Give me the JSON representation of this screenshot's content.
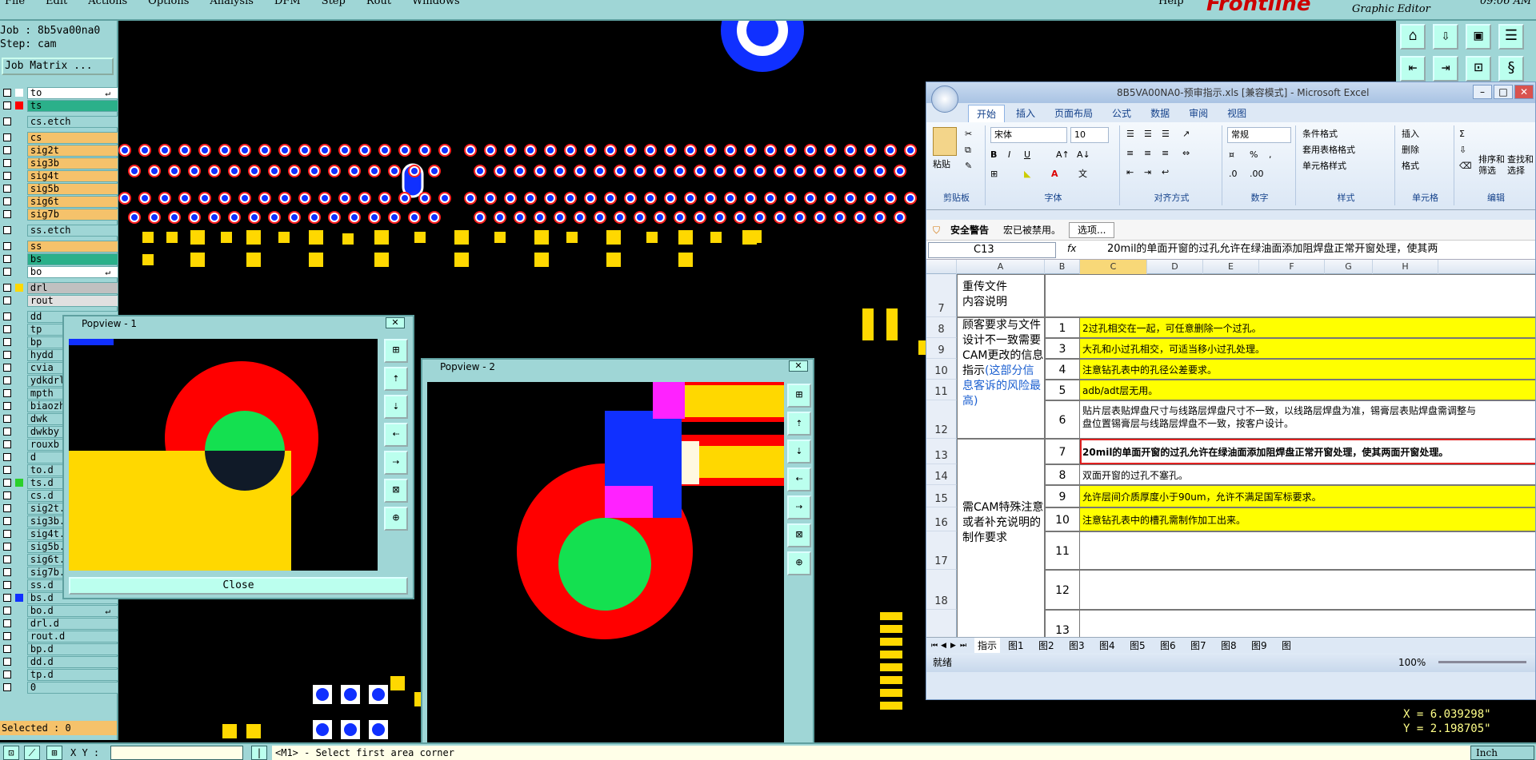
{
  "menu": {
    "items": [
      "File",
      "Edit",
      "Actions",
      "Options",
      "Analysis",
      "DFM",
      "Step",
      "Rout",
      "Windows"
    ],
    "help": "Help"
  },
  "brand": {
    "logo": "Frontline",
    "subtitle": "Graphic Editor",
    "time": "09:06 AM"
  },
  "job": {
    "job_line": "Job : 8b5va00na0",
    "step_line": "Step: cam",
    "matrix_button": "Job Matrix ..."
  },
  "layers": [
    {
      "name": "to",
      "color": "#ffffff",
      "swatch": "#ffffff",
      "arrow": true
    },
    {
      "name": "ts",
      "color": "#2bb08a",
      "swatch": "#ff0000"
    },
    {
      "name": "cs.etch",
      "color": "#9fd6d6",
      "swatch": "#9fd6d6",
      "gap": true
    },
    {
      "name": "cs",
      "color": "#f5c26b",
      "swatch": "#9fd6d6",
      "gap": true
    },
    {
      "name": "sig2t",
      "color": "#f5c26b",
      "swatch": "#9fd6d6"
    },
    {
      "name": "sig3b",
      "color": "#f5c26b",
      "swatch": "#9fd6d6"
    },
    {
      "name": "sig4t",
      "color": "#f5c26b",
      "swatch": "#9fd6d6"
    },
    {
      "name": "sig5b",
      "color": "#f5c26b",
      "swatch": "#9fd6d6"
    },
    {
      "name": "sig6t",
      "color": "#f5c26b",
      "swatch": "#9fd6d6"
    },
    {
      "name": "sig7b",
      "color": "#f5c26b",
      "swatch": "#9fd6d6"
    },
    {
      "name": "ss.etch",
      "color": "#9fd6d6",
      "swatch": "#9fd6d6",
      "gap": true
    },
    {
      "name": "ss",
      "color": "#f5c26b",
      "swatch": "#9fd6d6",
      "gap": true
    },
    {
      "name": "bs",
      "color": "#2bb08a",
      "swatch": "#9fd6d6"
    },
    {
      "name": "bo",
      "color": "#ffffff",
      "swatch": "#9fd6d6",
      "arrow": true
    },
    {
      "name": "drl",
      "color": "#c0c0c0",
      "swatch": "#ffd800",
      "gap": true
    },
    {
      "name": "rout",
      "color": "#e0e0e0",
      "swatch": "#9fd6d6"
    },
    {
      "name": "dd",
      "color": "#9fd6d6",
      "swatch": "#9fd6d6",
      "gap": true
    },
    {
      "name": "tp",
      "color": "#9fd6d6",
      "swatch": "#9fd6d6"
    },
    {
      "name": "bp",
      "color": "#9fd6d6",
      "swatch": "#9fd6d6"
    },
    {
      "name": "hydd",
      "color": "#9fd6d6",
      "swatch": "#9fd6d6"
    },
    {
      "name": "cvia",
      "color": "#9fd6d6",
      "swatch": "#9fd6d6"
    },
    {
      "name": "ydkdrl",
      "color": "#9fd6d6",
      "swatch": "#9fd6d6"
    },
    {
      "name": "mpth",
      "color": "#9fd6d6",
      "swatch": "#9fd6d6"
    },
    {
      "name": "biaozh",
      "color": "#9fd6d6",
      "swatch": "#9fd6d6"
    },
    {
      "name": "dwk",
      "color": "#9fd6d6",
      "swatch": "#9fd6d6"
    },
    {
      "name": "dwkby",
      "color": "#9fd6d6",
      "swatch": "#9fd6d6"
    },
    {
      "name": "rouxb",
      "color": "#9fd6d6",
      "swatch": "#9fd6d6"
    },
    {
      "name": "d",
      "color": "#9fd6d6",
      "swatch": "#9fd6d6"
    },
    {
      "name": "to.d",
      "color": "#9fd6d6",
      "swatch": "#9fd6d6"
    },
    {
      "name": "ts.d",
      "color": "#9fd6d6",
      "swatch": "#2bd02b"
    },
    {
      "name": "cs.d",
      "color": "#9fd6d6",
      "swatch": "#9fd6d6"
    },
    {
      "name": "sig2t.",
      "color": "#9fd6d6",
      "swatch": "#9fd6d6"
    },
    {
      "name": "sig3b.",
      "color": "#9fd6d6",
      "swatch": "#9fd6d6"
    },
    {
      "name": "sig4t.",
      "color": "#9fd6d6",
      "swatch": "#9fd6d6"
    },
    {
      "name": "sig5b.",
      "color": "#9fd6d6",
      "swatch": "#9fd6d6"
    },
    {
      "name": "sig6t.",
      "color": "#9fd6d6",
      "swatch": "#9fd6d6"
    },
    {
      "name": "sig7b.",
      "color": "#9fd6d6",
      "swatch": "#9fd6d6"
    },
    {
      "name": "ss.d",
      "color": "#9fd6d6",
      "swatch": "#9fd6d6"
    },
    {
      "name": "bs.d",
      "color": "#9fd6d6",
      "swatch": "#1030ff"
    },
    {
      "name": "bo.d",
      "color": "#9fd6d6",
      "swatch": "#9fd6d6",
      "arrow": true
    },
    {
      "name": "drl.d",
      "color": "#9fd6d6",
      "swatch": "#9fd6d6"
    },
    {
      "name": "rout.d",
      "color": "#9fd6d6",
      "swatch": "#9fd6d6"
    },
    {
      "name": "bp.d",
      "color": "#9fd6d6",
      "swatch": "#9fd6d6"
    },
    {
      "name": "dd.d",
      "color": "#9fd6d6",
      "swatch": "#9fd6d6"
    },
    {
      "name": "tp.d",
      "color": "#9fd6d6",
      "swatch": "#9fd6d6"
    },
    {
      "name": "0",
      "color": "#9fd6d6",
      "swatch": "#9fd6d6"
    }
  ],
  "status": {
    "selected": "Selected : 0",
    "xy_label": "X Y :",
    "xy_value": "",
    "message": "<M1> - Select first area corner",
    "unit": "Inch"
  },
  "coords": {
    "x": "X = 6.039298\"",
    "y": "Y = 2.198705\""
  },
  "popview1": {
    "title": "Popview - 1",
    "close_button": "Close"
  },
  "popview2": {
    "title": "Popview - 2"
  },
  "excel": {
    "title": "8B5VA00NA0-预审指示.xls [兼容模式] - Microsoft Excel",
    "tabs": [
      "开始",
      "插入",
      "页面布局",
      "公式",
      "数据",
      "审阅",
      "视图"
    ],
    "ribbon": {
      "paste": "粘贴",
      "clipboard": "剪贴板",
      "font_name": "宋体",
      "font_size": "10",
      "font_group": "字体",
      "align_group": "对齐方式",
      "number_format": "常规",
      "number_group": "数字",
      "cond_format": "条件格式",
      "table_format": "套用表格格式",
      "cell_style": "单元格样式",
      "style_group": "样式",
      "insert": "插入",
      "delete": "删除",
      "format": "格式",
      "cells_group": "单元格",
      "sort": "排序和\n筛选",
      "find": "查找和\n选择",
      "edit_group": "编辑"
    },
    "warning": {
      "label": "安全警告",
      "text": "宏已被禁用。",
      "options": "选项..."
    },
    "namebox": "C13",
    "formula": "20mil的单面开窗的过孔允许在绿油面添加阻焊盘正常开窗处理，使其两",
    "columns": [
      "A",
      "B",
      "C",
      "D",
      "E",
      "F",
      "G",
      "H"
    ],
    "rows": {
      "r7": {
        "num": "7",
        "a": "重传文件\n内容说明"
      },
      "group1": "顾客要求与文件设计不一致需要CAM更改的信息指示",
      "group1_note": "(这部分信息客诉的风险最高)",
      "group2": "需CAM特殊注意或者补充说明的制作要求",
      "items": [
        {
          "row": "8",
          "b": "1",
          "c": "2过孔相交在一起，可任意删除一个过孔。",
          "y": true
        },
        {
          "row": "9",
          "b": "3",
          "c": "大孔和小过孔相交，可适当移小过孔处理。",
          "y": true
        },
        {
          "row": "10",
          "b": "4",
          "c": "注意钻孔表中的孔径公差要求。",
          "y": true
        },
        {
          "row": "11",
          "b": "5",
          "c": "adb/adt层无用。",
          "y": true
        },
        {
          "row": "12",
          "b": "6",
          "c": "贴片层表贴焊盘尺寸与线路层焊盘尺寸不一致，以线路层焊盘为准，锡膏层表贴焊盘需调整与\n盘位置锡膏层与线路层焊盘不一致，按客户设计。",
          "y": false
        },
        {
          "row": "13",
          "b": "7",
          "c": "20mil的单面开窗的过孔允许在绿油面添加阻焊盘正常开窗处理，使其两面开窗处理。",
          "y": false
        },
        {
          "row": "14",
          "b": "8",
          "c": "双面开窗的过孔不塞孔。",
          "y": false
        },
        {
          "row": "15",
          "b": "9",
          "c": "允许层间介质厚度小于90um，允许不满足国军标要求。",
          "y": true
        },
        {
          "row": "16",
          "b": "10",
          "c": "注意钻孔表中的槽孔需制作加工出来。",
          "y": true
        },
        {
          "row": "17",
          "b": "11",
          "c": "",
          "y": false
        },
        {
          "row": "18",
          "b": "12",
          "c": "",
          "y": false
        },
        {
          "row": "",
          "b": "13",
          "c": "",
          "y": false
        }
      ]
    },
    "sheets": [
      "指示",
      "图1",
      "图2",
      "图3",
      "图4",
      "图5",
      "图6",
      "图7",
      "图8",
      "图9",
      "图"
    ],
    "status_ready": "就绪",
    "zoom": "100%"
  }
}
